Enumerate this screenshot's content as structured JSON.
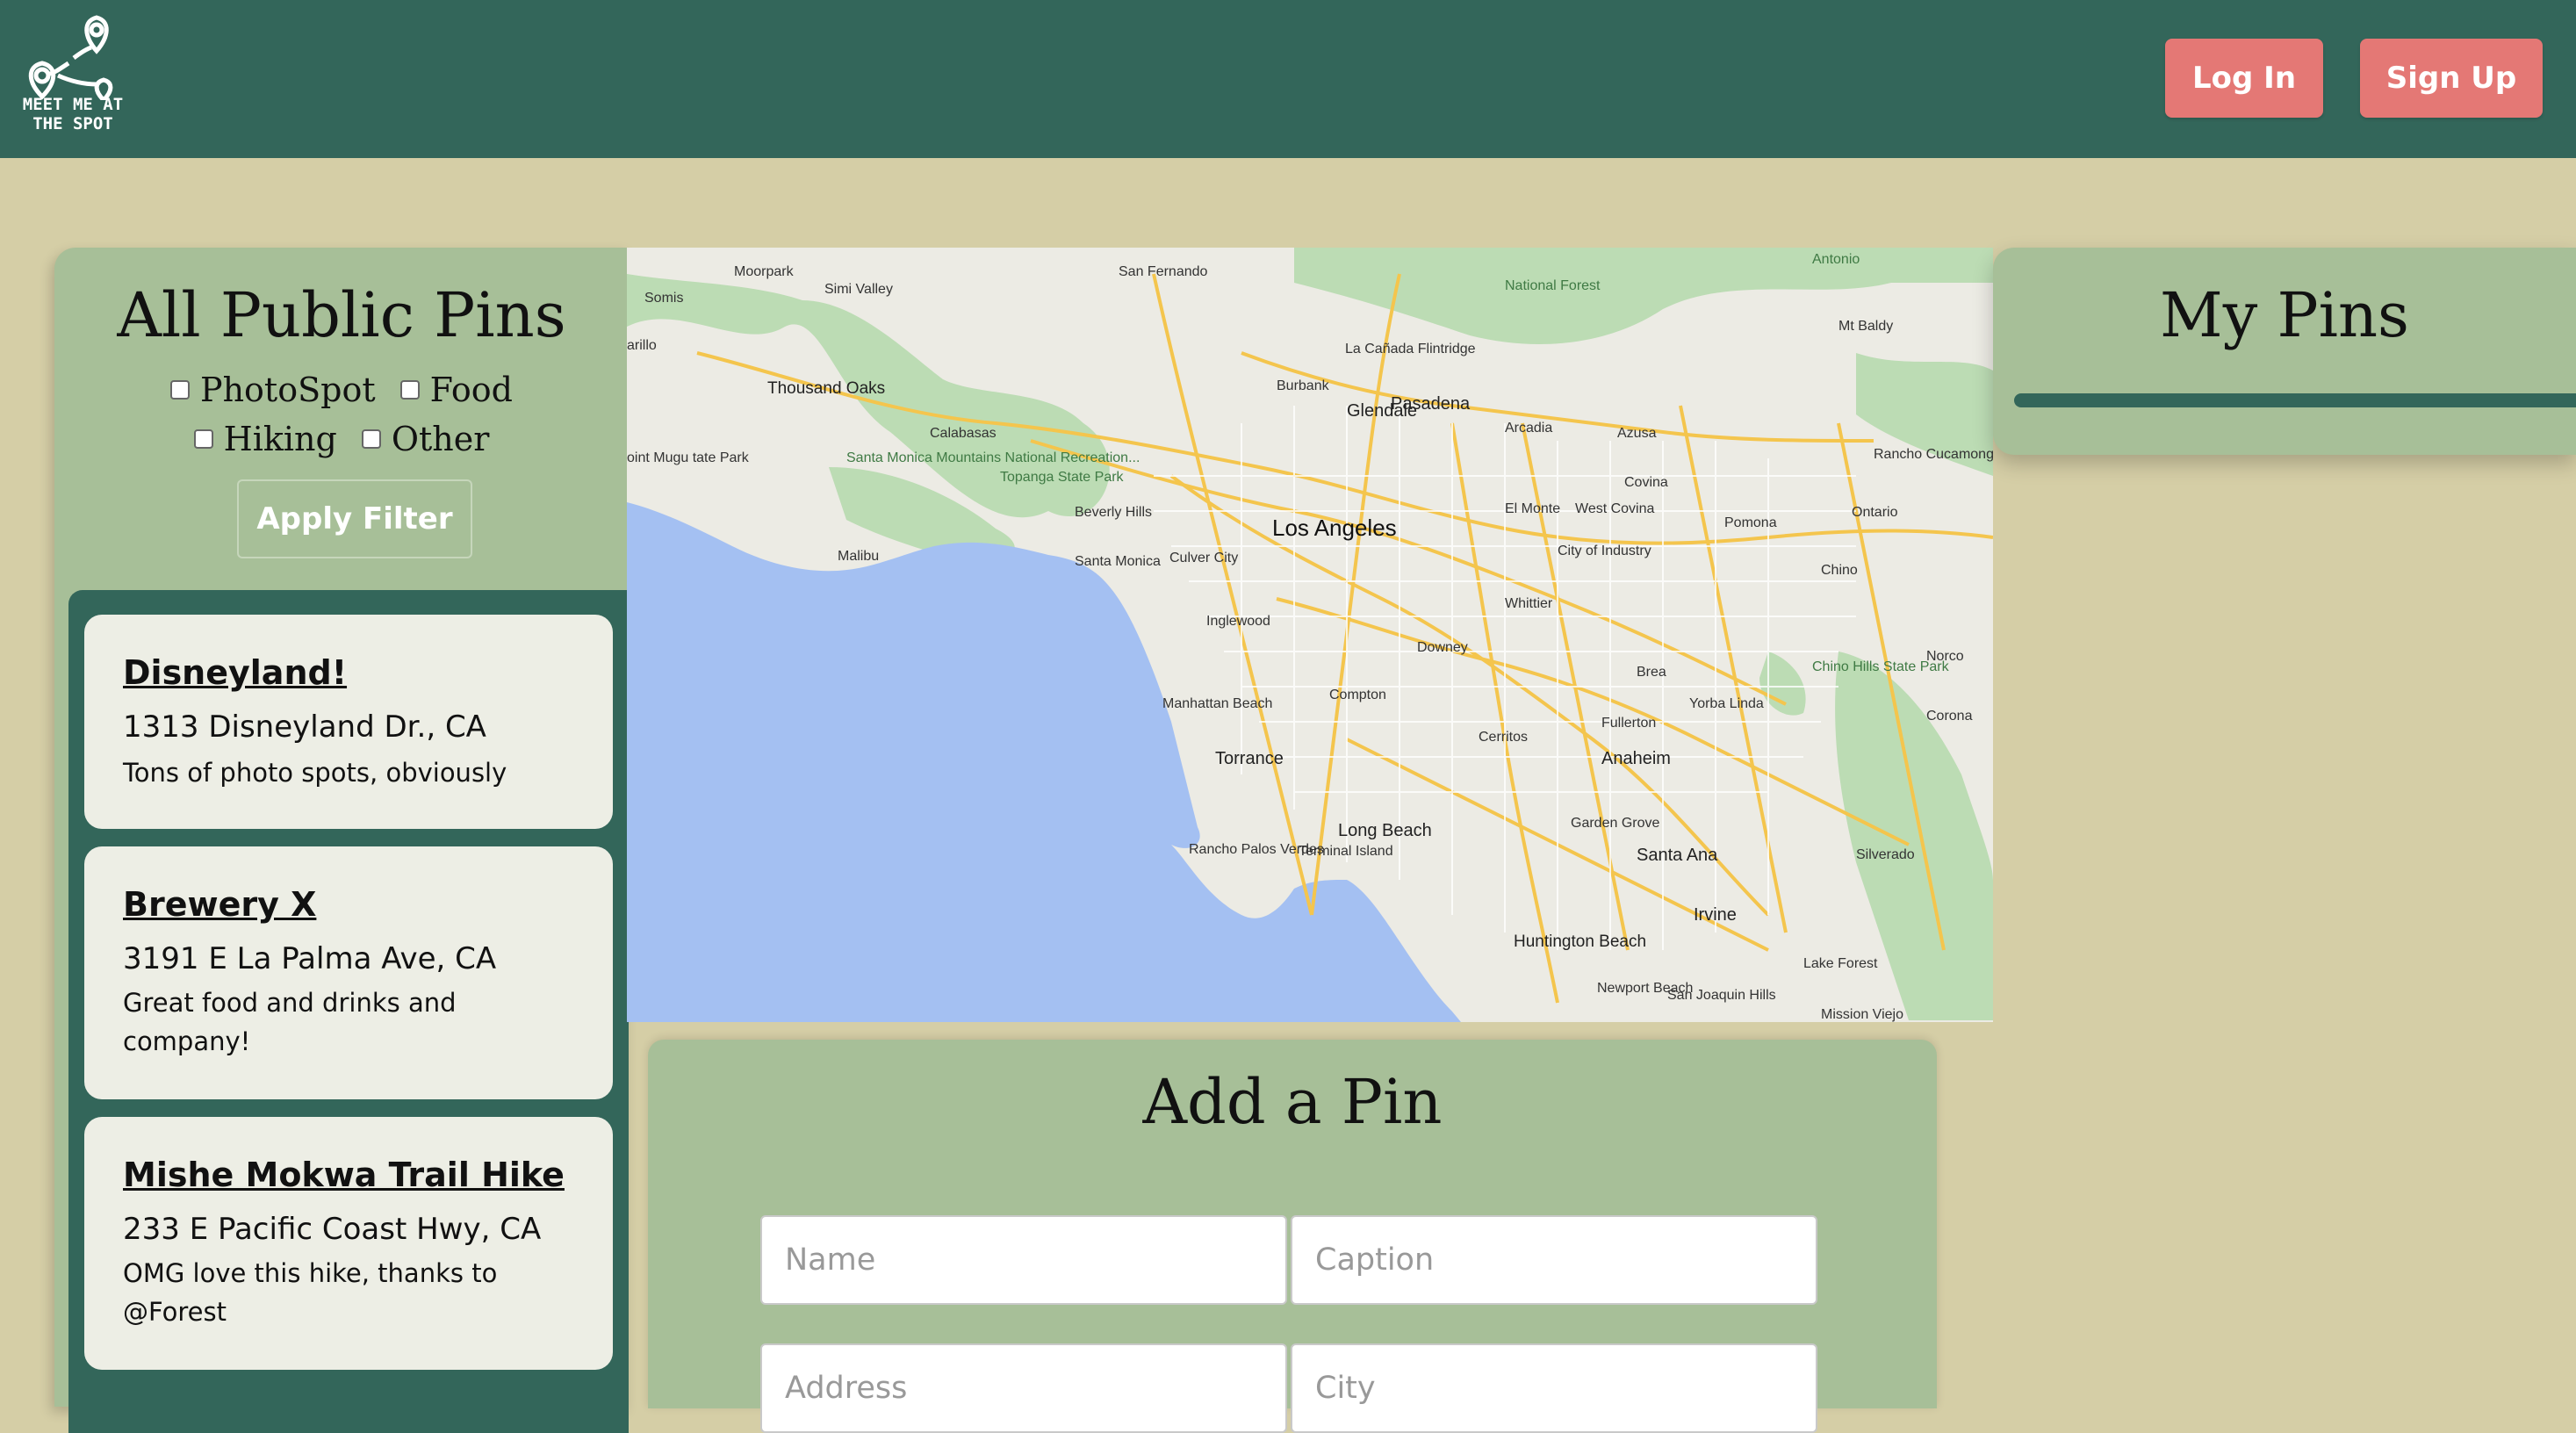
{
  "header": {
    "logo_text_line1": "MEET ME AT",
    "logo_text_line2": "THE SPOT",
    "login_label": "Log In",
    "signup_label": "Sign Up"
  },
  "colors": {
    "header_bg": "#33665a",
    "page_bg": "#d5cea6",
    "panel_bg": "#a7bf98",
    "button_accent": "#e47875",
    "card_bg": "#edeee5"
  },
  "public_pins": {
    "title": "All Public Pins",
    "filters": [
      {
        "label": "PhotoSpot",
        "checked": false
      },
      {
        "label": "Food",
        "checked": false
      },
      {
        "label": "Hiking",
        "checked": false
      },
      {
        "label": "Other",
        "checked": false
      }
    ],
    "apply_label": "Apply Filter",
    "pins": [
      {
        "name": "Disneyland!",
        "address": "1313 Disneyland Dr., CA",
        "caption": "Tons of photo spots, obviously"
      },
      {
        "name": "Brewery X",
        "address": "3191 E La Palma Ave, CA",
        "caption": "Great food and drinks and company!"
      },
      {
        "name": "Mishe Mokwa Trail Hike",
        "address": "233 E Pacific Coast Hwy, CA",
        "caption": "OMG love this hike, thanks to @Forest"
      }
    ]
  },
  "map": {
    "labels": {
      "la": "Los Angeles",
      "glendale": "Glendale",
      "pasadena": "Pasadena",
      "burbank": "Burbank",
      "sanfernando": "San Fernando",
      "simi": "Simi Valley",
      "moorpark": "Moorpark",
      "somis": "Somis",
      "thousandoaks": "Thousand Oaks",
      "calabasas": "Calabasas",
      "malibu": "Malibu",
      "santamonica": "Santa Monica",
      "culvercity": "Culver City",
      "beverlyhills": "Beverly Hills",
      "inglewood": "Inglewood",
      "manhattan": "Manhattan Beach",
      "torrance": "Torrance",
      "compton": "Compton",
      "downey": "Downey",
      "longbeach": "Long Beach",
      "anaheim": "Anaheim",
      "fullerton": "Fullerton",
      "santaana": "Santa Ana",
      "irvine": "Irvine",
      "huntington": "Huntington Beach",
      "pomona": "Pomona",
      "ontario": "Ontario",
      "chino": "Chino",
      "corona": "Corona",
      "norco": "Norco",
      "brea": "Brea",
      "yorbalinda": "Yorba Linda",
      "whittier": "Whittier",
      "covina": "Covina",
      "westcovina": "West Covina",
      "elmonte": "El Monte",
      "arcadia": "Arcadia",
      "azusa": "Azusa",
      "ranchocuc": "Rancho Cucamonga",
      "mtbaldy": "Mt Baldy",
      "antonio": "Antonio",
      "lacanada": "La Cañada Flintridge",
      "santamonicamtns": "Santa Monica Mountains National Recreation...",
      "topanga": "Topanga State Park",
      "chinohills": "Chino Hills State Park",
      "cerritos": "Cerritos",
      "gardengrove": "Garden Grove",
      "silverado": "Silverado",
      "lakeforest": "Lake Forest",
      "newport": "Newport Beach",
      "sanjoaquin": "San Joaquin Hills",
      "ranchopalos": "Rancho Palos Verdes",
      "terminal": "Terminal Island",
      "cityofindustry": "City of Industry",
      "pointmugu": "oint Mugu tate Park",
      "natforest": "National Forest",
      "missionviejo": "Mission Viejo",
      "carillo": "arillo"
    }
  },
  "add_pin": {
    "title": "Add a Pin",
    "name_placeholder": "Name",
    "caption_placeholder": "Caption",
    "address_placeholder": "Address",
    "city_placeholder": "City"
  },
  "my_pins": {
    "title": "My Pins"
  }
}
